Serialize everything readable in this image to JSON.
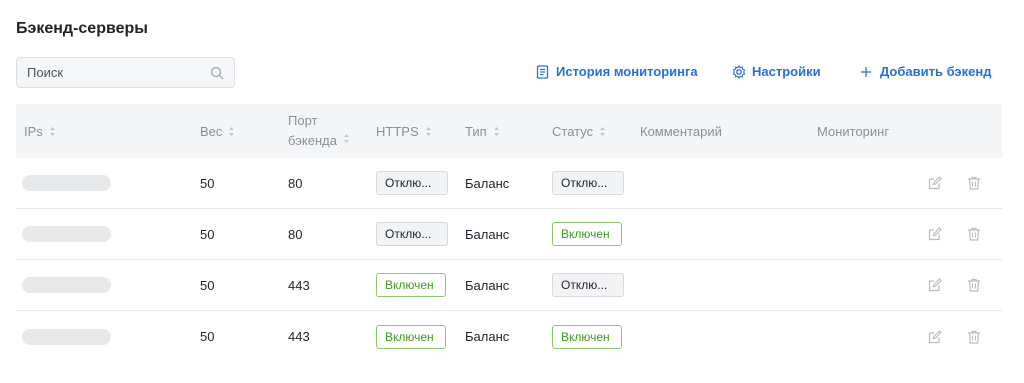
{
  "page": {
    "title": "Бэкенд-серверы"
  },
  "search": {
    "placeholder": "Поиск",
    "value": ""
  },
  "toolbar": {
    "history_label": "История мониторинга",
    "settings_label": "Настройки",
    "add_label": "Добавить бэкенд",
    "accent_color": "#2a6fd6"
  },
  "table": {
    "columns": [
      {
        "key": "ips",
        "label": "IPs",
        "sortable": true
      },
      {
        "key": "weight",
        "label": "Вес",
        "sortable": true
      },
      {
        "key": "port_line1",
        "label": "Порт",
        "sortable": true
      },
      {
        "key": "port_line2",
        "label": "бэкенда",
        "sortable": false
      },
      {
        "key": "https",
        "label": "HTTPS",
        "sortable": true
      },
      {
        "key": "type",
        "label": "Тип",
        "sortable": true
      },
      {
        "key": "status",
        "label": "Статус",
        "sortable": true
      },
      {
        "key": "comment",
        "label": "Комментарий",
        "sortable": false
      },
      {
        "key": "monitoring",
        "label": "Мониторинг",
        "sortable": false
      }
    ],
    "rows": [
      {
        "weight": "50",
        "port": "80",
        "https": "Отклю...",
        "https_state": "off",
        "type": "Баланс",
        "status": "Отклю...",
        "status_state": "off",
        "comment": ""
      },
      {
        "weight": "50",
        "port": "80",
        "https": "Отклю...",
        "https_state": "off",
        "type": "Баланс",
        "status": "Включен",
        "status_state": "on",
        "comment": ""
      },
      {
        "weight": "50",
        "port": "443",
        "https": "Включен",
        "https_state": "on",
        "type": "Баланс",
        "status": "Отклю...",
        "status_state": "off",
        "comment": ""
      },
      {
        "weight": "50",
        "port": "443",
        "https": "Включен",
        "https_state": "on",
        "type": "Баланс",
        "status": "Включен",
        "status_state": "on",
        "comment": ""
      }
    ],
    "row_icons": [
      "edit-icon",
      "trash-icon"
    ]
  },
  "colors": {
    "tag_on_text": "#3d9b1b",
    "tag_on_border": "#8cc96b",
    "tag_off_bg": "#f2f3f5",
    "header_bg": "#f4f5f7"
  }
}
